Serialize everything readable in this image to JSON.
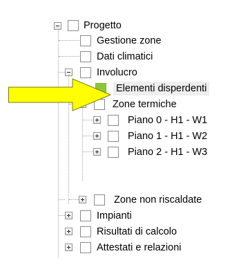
{
  "tree": {
    "items": [
      {
        "label": "Progetto",
        "expander": "minus",
        "checkbox": "empty"
      },
      {
        "label": "Gestione zone",
        "expander": "none",
        "checkbox": "empty"
      },
      {
        "label": "Dati climatici",
        "expander": "none",
        "checkbox": "empty"
      },
      {
        "label": "Involucro",
        "expander": "minus",
        "checkbox": "empty"
      },
      {
        "label": "Elementi disperdenti",
        "expander": "none",
        "checkbox": "filled",
        "selected": true
      },
      {
        "label": "Zone termiche",
        "expander": "minus",
        "checkbox": "empty"
      },
      {
        "label": "Piano 0 - H1 - W1",
        "expander": "plus",
        "checkbox": "empty"
      },
      {
        "label": "Piano 1 - H1 - W2",
        "expander": "plus",
        "checkbox": "empty"
      },
      {
        "label": "Piano 2 - H1 - W3",
        "expander": "plus",
        "checkbox": "empty"
      },
      {
        "label": "Zone non riscaldate",
        "expander": "plus",
        "checkbox": "empty"
      },
      {
        "label": "Impianti",
        "expander": "plus",
        "checkbox": "empty"
      },
      {
        "label": "Risultati di calcolo",
        "expander": "plus",
        "checkbox": "empty"
      },
      {
        "label": "Attestati e relazioni",
        "expander": "plus",
        "checkbox": "empty"
      }
    ]
  },
  "colors": {
    "checkbox_filled": "#8cc63f",
    "arrow_fill": "#ffff00",
    "arrow_stroke": "#7a7a00",
    "selection_bg": "#eeeeee"
  },
  "arrow": {
    "icon": "right-arrow-icon"
  }
}
